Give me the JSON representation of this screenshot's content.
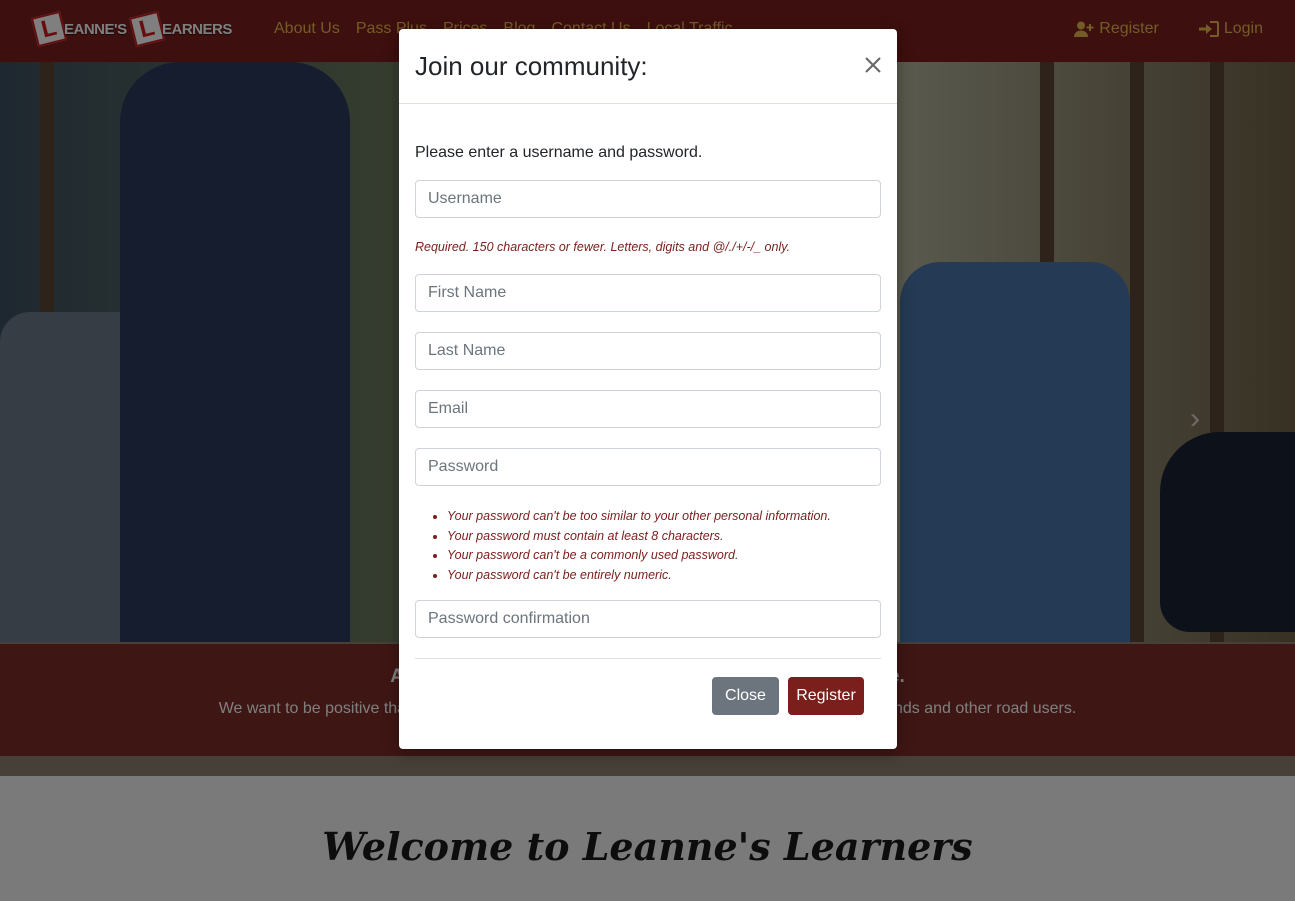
{
  "brand": {
    "plate_letter": "L",
    "word1": "EANNE'S",
    "word2": "EARNERS"
  },
  "nav": {
    "links": [
      "About Us",
      "Pass Plus",
      "Prices",
      "Blog",
      "Contact Us",
      "Local Traffic"
    ],
    "register_label": "Register",
    "login_label": "Login"
  },
  "hero": {
    "caption_title": "At Leanne's Learners we teach you to drive for a lifetime.",
    "caption_text": "We want to be positive that once you pass, you will be a safe driver for yourself, your family, friends and other road users.",
    "next_icon": "chevron-right-icon"
  },
  "welcome": {
    "title": "Welcome to Leanne's Learners"
  },
  "modal": {
    "title": "Join our community:",
    "intro": "Please enter a username and password.",
    "username_placeholder": "Username",
    "username_help": "Required. 150 characters or fewer. Letters, digits and @/./+/-/_ only.",
    "first_name_placeholder": "First Name",
    "last_name_placeholder": "Last Name",
    "email_placeholder": "Email",
    "password_placeholder": "Password",
    "password_help": [
      "Your password can't be too similar to your other personal information.",
      "Your password must contain at least 8 characters.",
      "Your password can't be a commonly used password.",
      "Your password can't be entirely numeric."
    ],
    "password_confirm_placeholder": "Password confirmation",
    "close_label": "Close",
    "register_label": "Register"
  },
  "colors": {
    "brand": "#7a1f1c",
    "nav_link": "#e8b84f",
    "secondary_button": "#6c757d"
  }
}
